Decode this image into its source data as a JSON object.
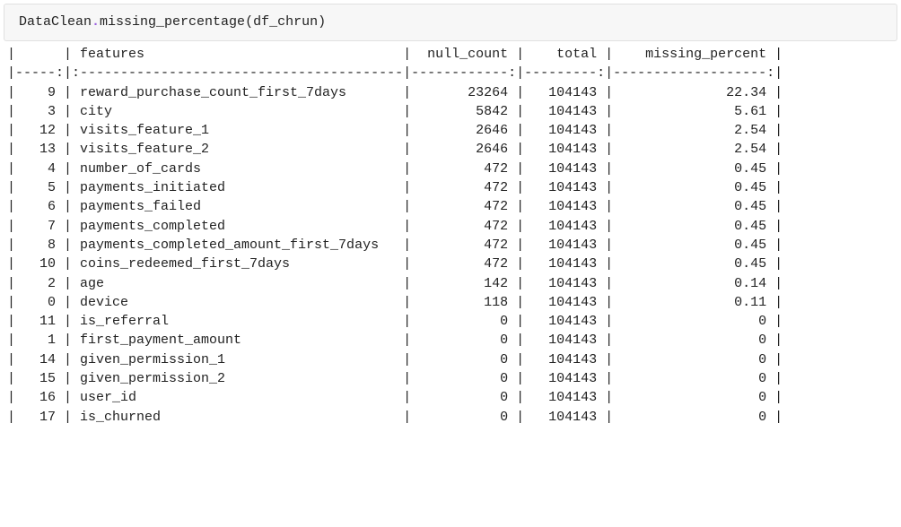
{
  "code_cell": {
    "class_name": "DataClean",
    "dot": ".",
    "function_name": "missing_percentage",
    "open_paren": "(",
    "argument": "df_chrun",
    "close_paren": ")"
  },
  "chart_data": {
    "type": "table",
    "columns": {
      "idx_w": 4,
      "feat_label": "features",
      "feat_w": 39,
      "null_label": "null_count",
      "null_w": 11,
      "total_label": "total",
      "total_w": 8,
      "miss_label": "missing_percent",
      "miss_w": 18
    },
    "rows": [
      {
        "idx": "9",
        "feature": "reward_purchase_count_first_7days",
        "null_count": "23264",
        "total": "104143",
        "missing_percent": "22.34"
      },
      {
        "idx": "3",
        "feature": "city",
        "null_count": "5842",
        "total": "104143",
        "missing_percent": "5.61"
      },
      {
        "idx": "12",
        "feature": "visits_feature_1",
        "null_count": "2646",
        "total": "104143",
        "missing_percent": "2.54"
      },
      {
        "idx": "13",
        "feature": "visits_feature_2",
        "null_count": "2646",
        "total": "104143",
        "missing_percent": "2.54"
      },
      {
        "idx": "4",
        "feature": "number_of_cards",
        "null_count": "472",
        "total": "104143",
        "missing_percent": "0.45"
      },
      {
        "idx": "5",
        "feature": "payments_initiated",
        "null_count": "472",
        "total": "104143",
        "missing_percent": "0.45"
      },
      {
        "idx": "6",
        "feature": "payments_failed",
        "null_count": "472",
        "total": "104143",
        "missing_percent": "0.45"
      },
      {
        "idx": "7",
        "feature": "payments_completed",
        "null_count": "472",
        "total": "104143",
        "missing_percent": "0.45"
      },
      {
        "idx": "8",
        "feature": "payments_completed_amount_first_7days",
        "null_count": "472",
        "total": "104143",
        "missing_percent": "0.45"
      },
      {
        "idx": "10",
        "feature": "coins_redeemed_first_7days",
        "null_count": "472",
        "total": "104143",
        "missing_percent": "0.45"
      },
      {
        "idx": "2",
        "feature": "age",
        "null_count": "142",
        "total": "104143",
        "missing_percent": "0.14"
      },
      {
        "idx": "0",
        "feature": "device",
        "null_count": "118",
        "total": "104143",
        "missing_percent": "0.11"
      },
      {
        "idx": "11",
        "feature": "is_referral",
        "null_count": "0",
        "total": "104143",
        "missing_percent": "0"
      },
      {
        "idx": "1",
        "feature": "first_payment_amount",
        "null_count": "0",
        "total": "104143",
        "missing_percent": "0"
      },
      {
        "idx": "14",
        "feature": "given_permission_1",
        "null_count": "0",
        "total": "104143",
        "missing_percent": "0"
      },
      {
        "idx": "15",
        "feature": "given_permission_2",
        "null_count": "0",
        "total": "104143",
        "missing_percent": "0"
      },
      {
        "idx": "16",
        "feature": "user_id",
        "null_count": "0",
        "total": "104143",
        "missing_percent": "0"
      },
      {
        "idx": "17",
        "feature": "is_churned",
        "null_count": "0",
        "total": "104143",
        "missing_percent": "0"
      }
    ]
  }
}
